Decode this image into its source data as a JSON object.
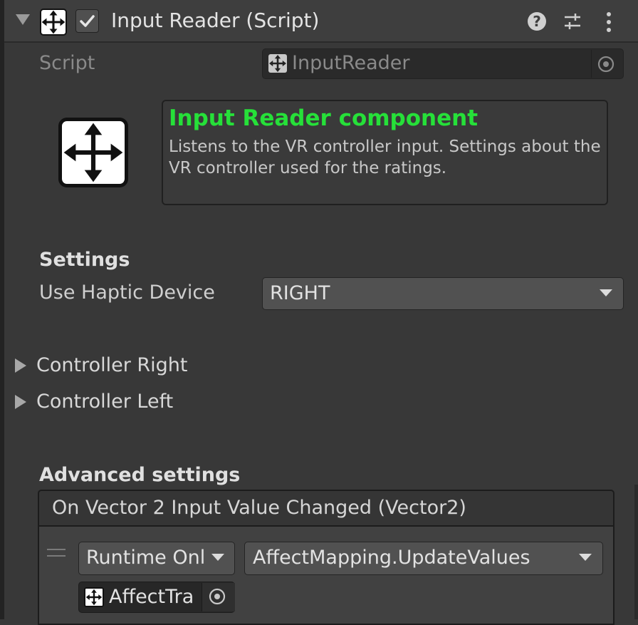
{
  "component": {
    "title": "Input Reader (Script)",
    "help_glyph": "?",
    "enabled": true
  },
  "script_row": {
    "label": "Script",
    "value": "InputReader"
  },
  "info": {
    "title": "Input Reader component",
    "description": "Listens to the VR controller input. Settings about the VR controller used for the ratings."
  },
  "settings": {
    "heading": "Settings",
    "haptic_label": "Use Haptic Device",
    "haptic_value": "RIGHT"
  },
  "foldouts": [
    "Controller Right",
    "Controller Left"
  ],
  "advanced": {
    "heading": "Advanced settings",
    "event_title": "On Vector 2 Input Value Changed (Vector2)",
    "call_state": "Runtime Onl",
    "function": "AffectMapping.UpdateValues",
    "target_object": "AffectTra"
  },
  "colors": {
    "accent_green": "#26e039",
    "panel_bg": "#383838"
  },
  "icons": [
    "move-arrows-icon",
    "checkmark-icon",
    "help-icon",
    "presets-icon",
    "kebab-menu-icon",
    "object-picker-icon",
    "dropdown-arrow-icon",
    "foldout-arrow-icon",
    "drag-handle-icon"
  ]
}
